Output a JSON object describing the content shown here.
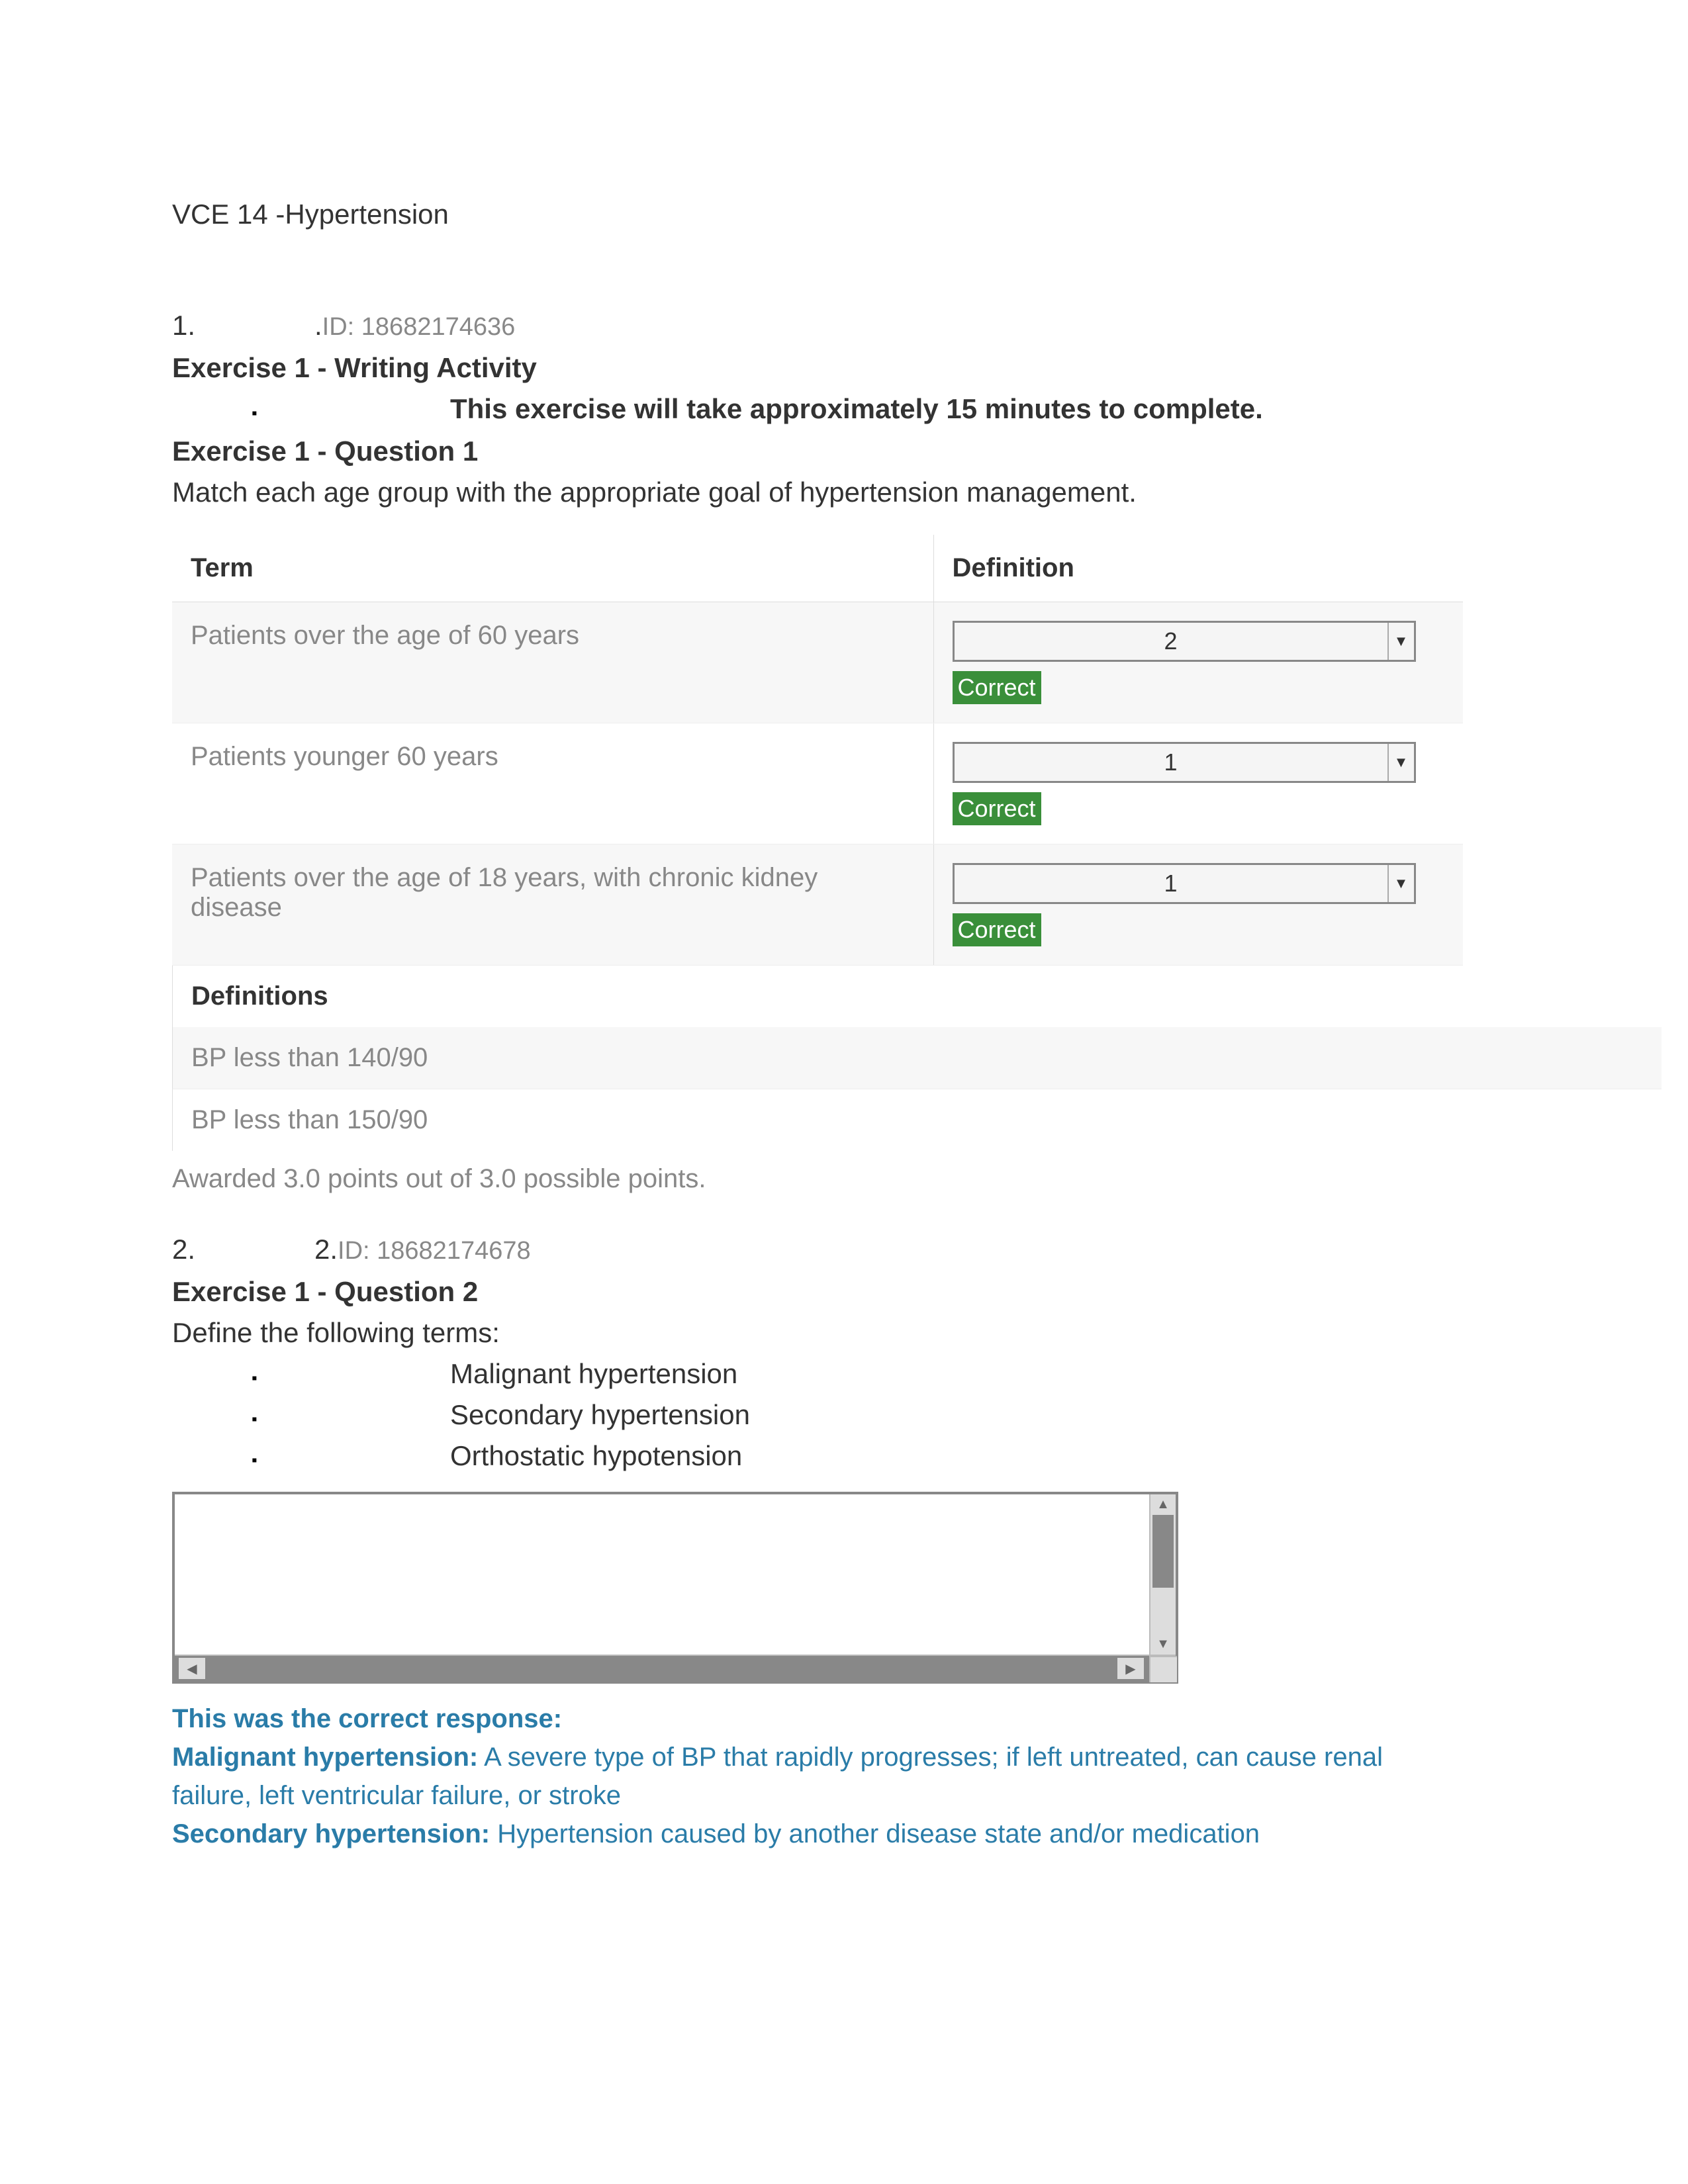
{
  "document": {
    "title": "VCE 14 -Hypertension"
  },
  "questions": [
    {
      "number": "1.",
      "pre_id": ".",
      "id_label": "ID: 18682174636",
      "exercise_title": "Exercise 1 - Writing Activity",
      "time_note": "This exercise will take approximately 15 minutes to complete.",
      "subtitle": "Exercise 1 - Question 1",
      "prompt": "Match each age group with the appropriate goal of hypertension management.",
      "table": {
        "headers": [
          "Term",
          "Definition"
        ],
        "rows": [
          {
            "term": "Patients over the age of 60 years",
            "value": "2",
            "status": "Correct"
          },
          {
            "term": "Patients younger 60 years",
            "value": "1",
            "status": "Correct"
          },
          {
            "term": "Patients over the age of 18 years, with chronic kidney disease",
            "value": "1",
            "status": "Correct"
          }
        ]
      },
      "definitions": {
        "header": "Definitions",
        "items": [
          "BP less than 140/90",
          "BP less than 150/90"
        ]
      },
      "awarded": "Awarded 3.0 points out of 3.0 possible points."
    },
    {
      "number": "2.",
      "pre_id": "2.",
      "id_label": "ID: 18682174678",
      "subtitle": "Exercise 1 - Question 2",
      "prompt": "Define the following terms:",
      "terms": [
        "Malignant hypertension",
        "Secondary hypertension",
        "Orthostatic hypotension"
      ],
      "feedback": {
        "lead": "This was the correct response:",
        "items": [
          {
            "term": "Malignant hypertension:",
            "def": " A severe type of BP that rapidly progresses; if left untreated, can cause renal failure, left ventricular failure, or stroke"
          },
          {
            "term": "Secondary hypertension:",
            "def": " Hypertension caused by another disease state and/or medication"
          }
        ]
      }
    }
  ]
}
